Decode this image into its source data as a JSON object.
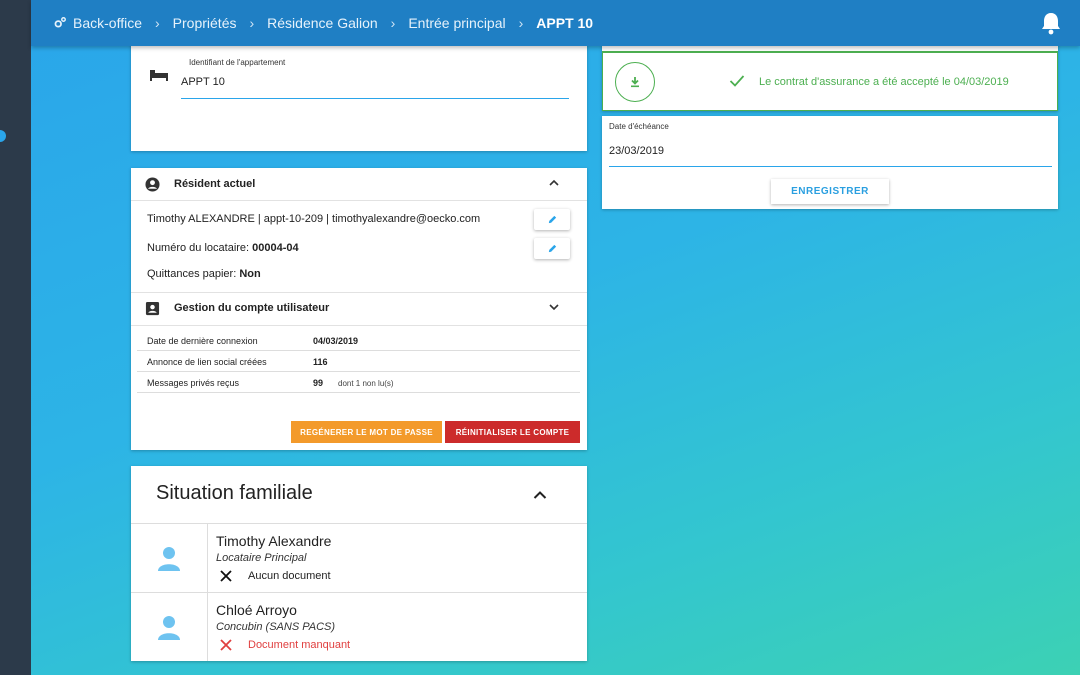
{
  "breadcrumb": {
    "items": [
      "Back-office",
      "Propriétés",
      "Résidence Galion",
      "Entrée principal",
      "APPT 10"
    ]
  },
  "apartment": {
    "label": "Identifiant de l'appartement",
    "value": "APPT 10"
  },
  "resident": {
    "section_title": "Résident actuel",
    "summary": "Timothy ALEXANDRE | appt-10-209 | timothyalexandre@oecko.com",
    "tenant_number_label": "Numéro du locataire: ",
    "tenant_number": "00004-04",
    "paper_receipts_label": "Quittances papier: ",
    "paper_receipts": "Non"
  },
  "account": {
    "section_title": "Gestion du compte utilisateur",
    "stats": [
      {
        "label": "Date de dernière connexion",
        "value": "04/03/2019",
        "extra": ""
      },
      {
        "label": "Annonce de lien social créées",
        "value": "116",
        "extra": ""
      },
      {
        "label": "Messages privés reçus",
        "value": "99",
        "extra": "dont 1 non lu(s)"
      }
    ],
    "regen_password_label": "REGÉNERER LE MOT DE PASSE",
    "reset_account_label": "RÉINITIALISER LE COMPTE"
  },
  "family": {
    "title": "Situation familiale",
    "members": [
      {
        "name": "Timothy Alexandre",
        "role": "Locataire Principal",
        "doc_status": "Aucun document",
        "doc_icon": "close-icon"
      },
      {
        "name": "Chloé Arroyo",
        "role": "Concubin (SANS PACS)",
        "doc_status": "Document manquant",
        "doc_icon": "close-icon-red"
      }
    ]
  },
  "insurance": {
    "message": "Le contrat d'assurance a été accepté le 04/03/2019",
    "due_date_label": "Date d'échéance",
    "due_date_value": "23/03/2019",
    "save_label": "ENREGISTRER"
  },
  "colors": {
    "accent": "#2aa5ea",
    "topbar": "#1f7fc4",
    "success": "#4caf50",
    "warning": "#f39a2b",
    "danger": "#cc2b2b"
  }
}
